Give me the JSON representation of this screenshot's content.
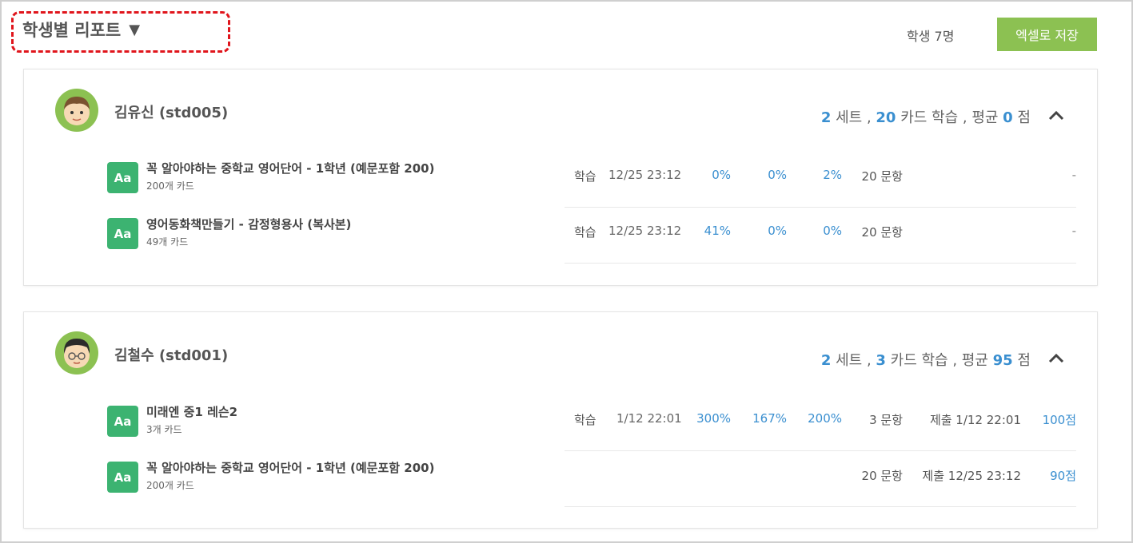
{
  "header": {
    "title": "학생별 리포트",
    "dropdown_icon": "triangle-down-icon",
    "student_count": "학생 7명",
    "excel_button": "엑셀로 저장",
    "excel_button_color": "#8cc152"
  },
  "students": [
    {
      "name": "김유신 (std005)",
      "summary": {
        "sets": "2",
        "sets_label": " 세트 , ",
        "cards": "20",
        "cards_label": " 카드 학습 , 평균 ",
        "avg": "0",
        "avg_label": " 점"
      },
      "sets": [
        {
          "badge": "Aa",
          "title": "꼭 알아야하는 중학교 영어단어 - 1학년 (예문포함 200)",
          "count": "200개 카드",
          "label": "학습",
          "time": "12/25 23:12",
          "p1": "0%",
          "p2": "0%",
          "p3": "2%",
          "questions": "20 문항",
          "submit": "",
          "score": "-"
        },
        {
          "badge": "Aa",
          "title": "영어동화책만들기 - 감정형용사 (복사본)",
          "count": "49개 카드",
          "label": "학습",
          "time": "12/25 23:12",
          "p1": "41%",
          "p2": "0%",
          "p3": "0%",
          "questions": "20 문항",
          "submit": "",
          "score": "-"
        }
      ]
    },
    {
      "name": "김철수 (std001)",
      "summary": {
        "sets": "2",
        "sets_label": " 세트 , ",
        "cards": "3",
        "cards_label": " 카드 학습 , 평균 ",
        "avg": "95",
        "avg_label": " 점"
      },
      "sets": [
        {
          "badge": "Aa",
          "title": "미래엔 중1 레슨2",
          "count": "3개 카드",
          "label": "학습",
          "time": "1/12 22:01",
          "p1": "300%",
          "p2": "167%",
          "p3": "200%",
          "questions": "3 문항",
          "submit": "제출 1/12 22:01",
          "score": "100점"
        },
        {
          "badge": "Aa",
          "title": "꼭 알아야하는 중학교 영어단어 - 1학년 (예문포함 200)",
          "count": "200개 카드",
          "label": "",
          "time": "",
          "p1": "",
          "p2": "",
          "p3": "",
          "questions": "20 문항",
          "submit": "제출 12/25 23:12",
          "score": "90점"
        }
      ]
    }
  ],
  "colors": {
    "accent": "#3a8fd0",
    "badge": "#3cb371",
    "annotation": "#e0151c"
  }
}
